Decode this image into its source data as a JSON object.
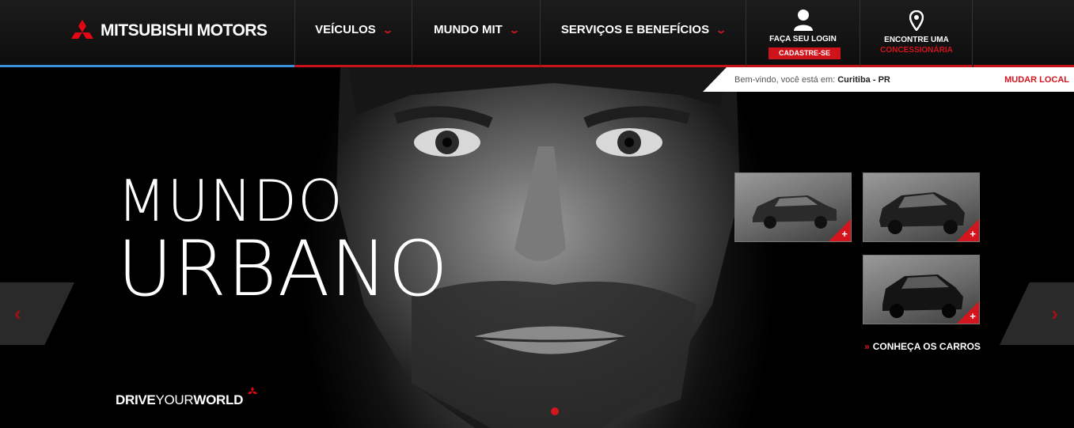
{
  "header": {
    "logo_text": "MITSUBISHI MOTORS",
    "nav": [
      {
        "label": "VEÍCULOS"
      },
      {
        "label": "MUNDO MIT"
      },
      {
        "label": "SERVIÇOS E BENEFÍCIOS"
      }
    ],
    "login": {
      "label": "FAÇA SEU LOGIN",
      "register": "CADASTRE-SE"
    },
    "dealer": {
      "line1": "ENCONTRE UMA",
      "line2": "CONCESSIONÁRIA"
    }
  },
  "location": {
    "prefix": "Bem-vindo, você está em: ",
    "city": "Curitiba - PR",
    "change": "MUDAR LOCAL"
  },
  "hero": {
    "title_line1": "MUNDO",
    "title_line2": "URBANO",
    "slogan_bold1": "DRIVE",
    "slogan_light": "YOUR",
    "slogan_bold2": "WORLD",
    "cars_link": "CONHEÇA OS CARROS",
    "cars_link_icon": "double-chevron-right-icon",
    "prev_icon": "chevron-left-icon",
    "next_icon": "chevron-right-icon",
    "thumb_badge": "+"
  },
  "colors": {
    "accent_red": "#d4151e",
    "accent_blue": "#3a8fd8"
  }
}
